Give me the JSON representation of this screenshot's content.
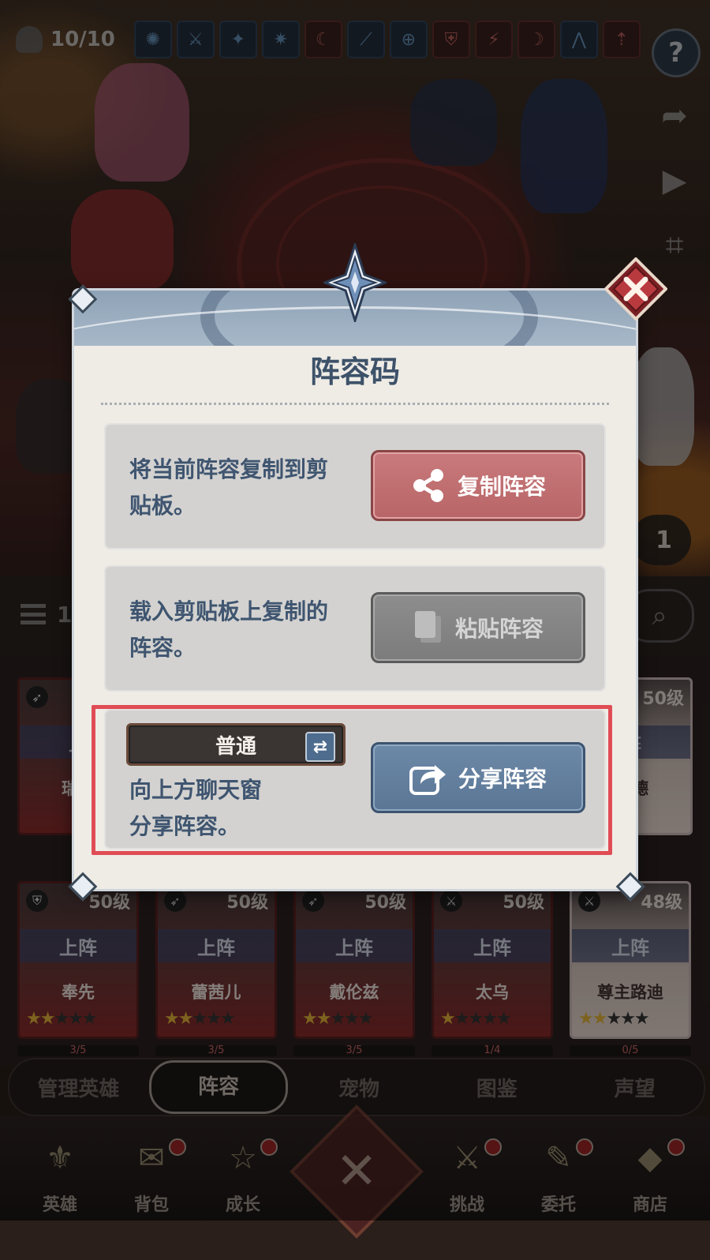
{
  "top_bar": {
    "hero_count": "10/10",
    "class_icons": [
      "guardian-icon",
      "sword-icon",
      "star-icon",
      "burst-icon",
      "crescent-icon",
      "feather-icon",
      "target-icon",
      "shield-icon",
      "runner-icon",
      "scythe-icon",
      "wings-icon",
      "moon-arrow-icon"
    ],
    "help_label": "?"
  },
  "side_toggle": {
    "count": "1"
  },
  "list_header": {
    "count_partial": "1"
  },
  "hero_cards": [
    {
      "level": "50级",
      "deploy": "上阵",
      "name": "奉先",
      "stars": 2,
      "class_icon": "shield-icon"
    },
    {
      "level": "50级",
      "deploy": "上阵",
      "name": "蕾茜儿",
      "stars": 2,
      "class_icon": "bow-icon"
    },
    {
      "level": "50级",
      "deploy": "上阵",
      "name": "戴伦兹",
      "stars": 2,
      "class_icon": "bow-icon"
    },
    {
      "level": "50级",
      "deploy": "上阵",
      "name": "太乌",
      "stars": 1,
      "class_icon": "sword-icon"
    },
    {
      "level": "48级",
      "deploy": "上阵",
      "name": "尊主路迪",
      "stars": 2,
      "class_icon": "sword-icon"
    }
  ],
  "partial_cards": {
    "left": {
      "deploy": "上",
      "name": "瑞吉"
    },
    "right": {
      "level": "50级",
      "deploy": "阵",
      "name": "尔德"
    }
  },
  "fragments": [
    "3/5",
    "3/5",
    "3/5",
    "1/4",
    "0/5"
  ],
  "tabs": [
    {
      "label": "管理英雄",
      "active": false
    },
    {
      "label": "阵容",
      "active": true
    },
    {
      "label": "宠物",
      "active": false
    },
    {
      "label": "图鉴",
      "active": false
    },
    {
      "label": "声望",
      "active": false
    }
  ],
  "bottom_nav": [
    {
      "label": "英雄",
      "icon": "hero-crest-icon",
      "dot": false
    },
    {
      "label": "背包",
      "icon": "backpack-icon",
      "dot": true
    },
    {
      "label": "成长",
      "icon": "book-icon",
      "dot": true
    },
    {
      "label": "挑战",
      "icon": "helmet-icon",
      "dot": true
    },
    {
      "label": "委托",
      "icon": "scroll-icon",
      "dot": true
    },
    {
      "label": "商店",
      "icon": "chest-icon",
      "dot": true
    }
  ],
  "dialog": {
    "title": "阵容码",
    "copy_section": {
      "desc_line1": "将当前阵容复制到剪",
      "desc_line2": "贴板。",
      "button": "复制阵容"
    },
    "paste_section": {
      "desc_line1": "载入剪贴板上复制的",
      "desc_line2": "阵容。",
      "button": "粘贴阵容"
    },
    "share_section": {
      "mode": "普通",
      "desc_line1": "向上方聊天窗",
      "desc_line2": "分享阵容。",
      "button": "分享阵容"
    }
  },
  "colors": {
    "accent_red": "#b86567",
    "accent_blue": "#5b7695",
    "highlight": "#e04c55",
    "title_blue": "#3d5269"
  }
}
